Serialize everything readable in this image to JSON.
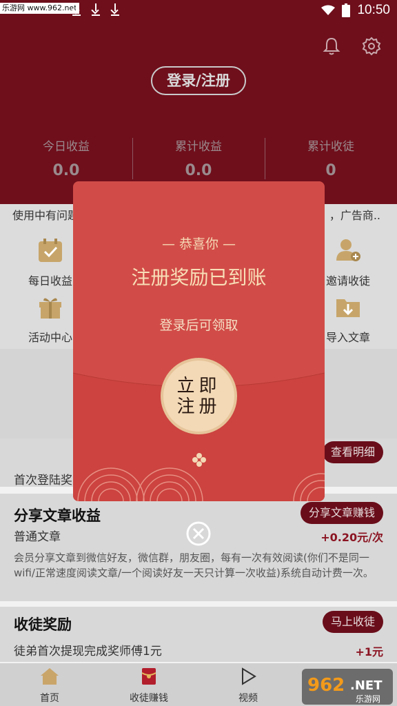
{
  "status_bar": {
    "watermark": "乐游网 www.962.net",
    "time": "10:50"
  },
  "header": {
    "login_button": "登录/注册",
    "stats": [
      {
        "label": "今日收益",
        "value": "0.0"
      },
      {
        "label": "累计收益",
        "value": "0.0"
      },
      {
        "label": "累计收徒",
        "value": "0"
      }
    ]
  },
  "notice": {
    "left": "使用中有问题",
    "right": "，广告商.."
  },
  "grid": [
    {
      "label": "每日收益",
      "icon": "calendar-check-icon",
      "color": "#c7a56a"
    },
    {
      "label": "活动中心",
      "icon": "gift-icon",
      "color": "#c7a56a"
    },
    {
      "label": "邀请收徒",
      "icon": "add-user-icon",
      "color": "#c7a56a"
    },
    {
      "label": "导入文章",
      "icon": "import-folder-icon",
      "color": "#c7a56a"
    }
  ],
  "first_login": {
    "label": "首次登陆奖",
    "button": "查看明细"
  },
  "share_card": {
    "title": "分享文章收益",
    "button": "分享文章赚钱",
    "subtitle": "普通文章",
    "reward": "+0.20元/次",
    "description": "会员分享文章到微信好友，微信群，朋友圈，每有一次有效阅读(你们不是同一wifi/正常速度阅读文章/一个阅读好友一天只计算一次收益)系统自动计费一次。"
  },
  "apprentice_card": {
    "title": "收徒奖励",
    "button": "马上收徒",
    "subtitle": "徒弟首次提现完成奖师傅1元",
    "reward": "+1元"
  },
  "bottom_nav": [
    {
      "label": "首页",
      "icon": "home-icon"
    },
    {
      "label": "收徒赚钱",
      "icon": "red-envelope-icon"
    },
    {
      "label": "视频",
      "icon": "play-icon"
    }
  ],
  "dialog": {
    "congrats": "— 恭喜你 —",
    "title": "注册奖励已到账",
    "subtitle": "登录后可领取",
    "open_button": "立即注册"
  },
  "colors": {
    "header_bg": "#6f0f1c",
    "packet_red": "#d14c48",
    "gold": "#f3d9b6"
  }
}
